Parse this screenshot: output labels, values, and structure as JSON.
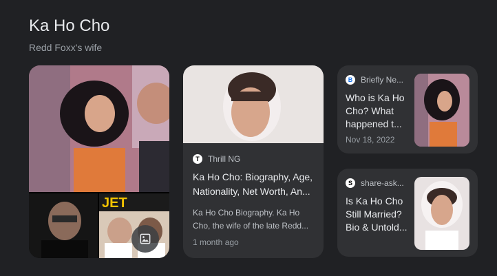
{
  "header": {
    "title": "Ka Ho Cho",
    "subtitle": "Redd Foxx's wife"
  },
  "collage": {
    "main_image": "cher-and-redd-foxx-photo",
    "bottom_left_image": "redd-foxx-photo",
    "bottom_right_image": "jet-magazine-cover",
    "jet_text": "JET",
    "more_images_icon": "image-icon"
  },
  "results": [
    {
      "source": "Thrill NG",
      "favicon": "T",
      "favicon_color": "#000000",
      "title": "Ka Ho Cho: Biography, Age, Nationality, Net Worth, An...",
      "snippet": "Ka Ho Cho Biography. Ka Ho Cho, the wife of the late Redd...",
      "date": "1 month ago"
    },
    {
      "source": "Briefly Ne...",
      "favicon": "B",
      "favicon_color": "#1a73e8",
      "title": "Who is Ka Ho Cho? What happened t...",
      "date": "Nov 18, 2022"
    },
    {
      "source": "share-ask...",
      "favicon": "S",
      "favicon_color": "#000000",
      "title": "Is Ka Ho Cho Still Married? Bio & Untold..."
    }
  ]
}
